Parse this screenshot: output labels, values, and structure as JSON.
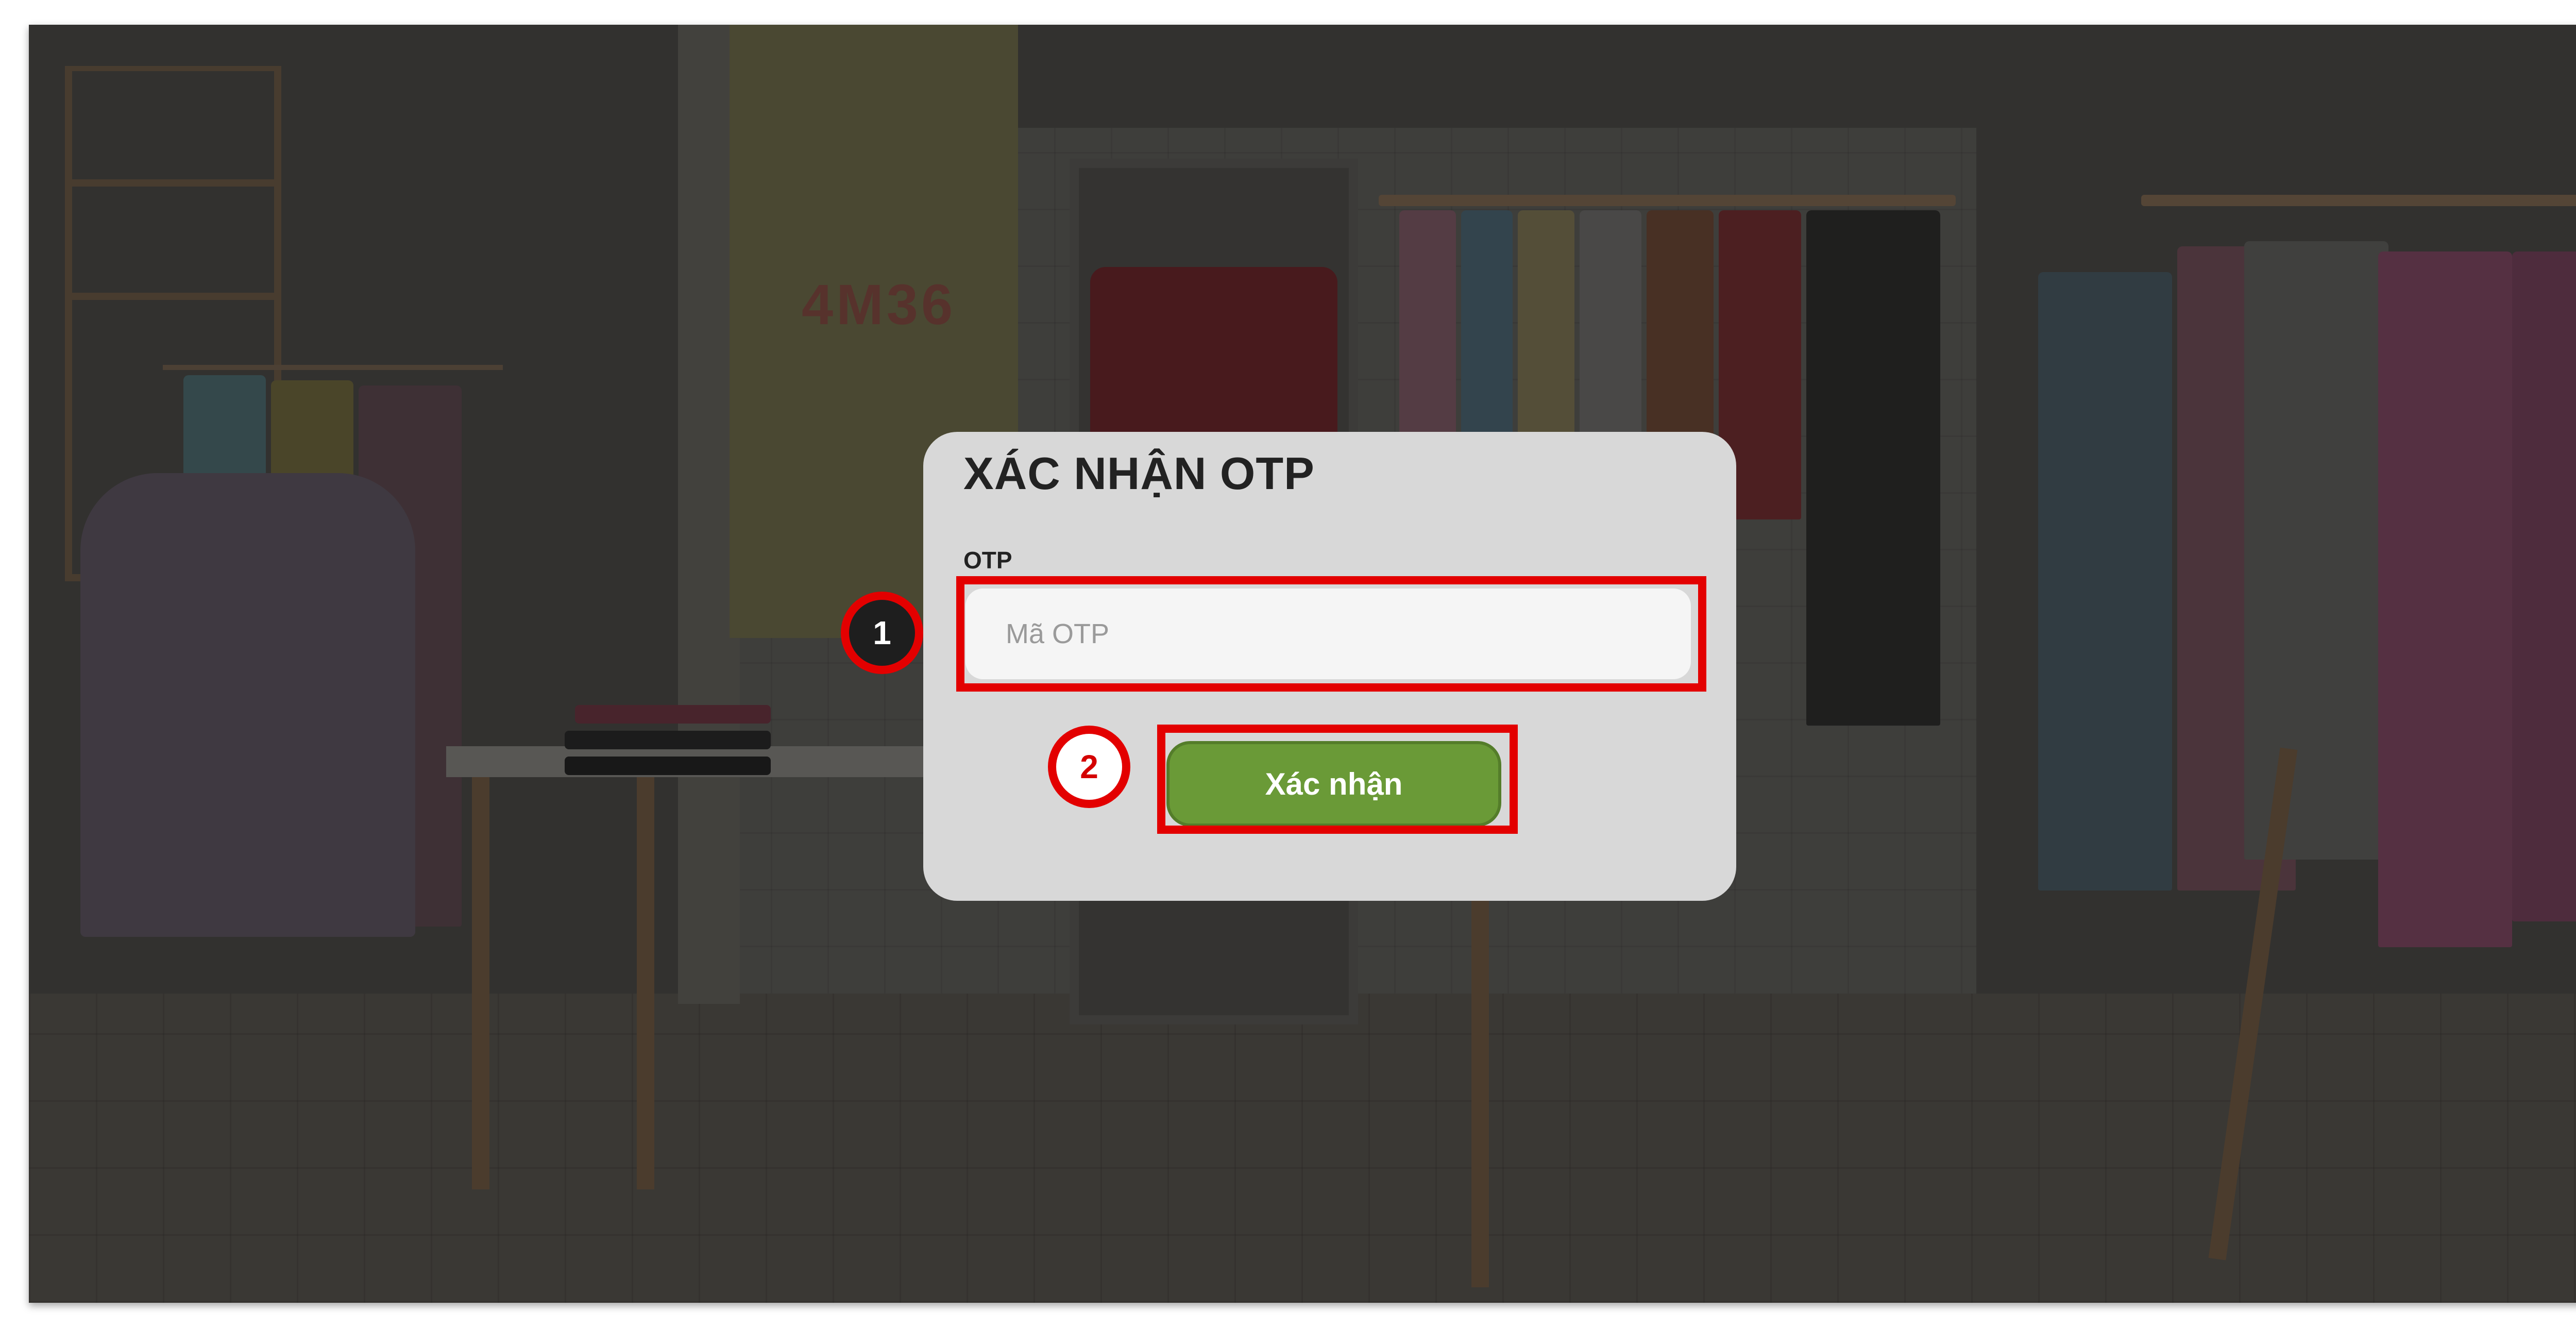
{
  "modal": {
    "title": "XÁC NHẬN OTP",
    "otp_label": "OTP",
    "otp_placeholder": "Mã OTP",
    "otp_value": "",
    "confirm_label": "Xác nhận"
  },
  "background": {
    "poster_text": "4M36"
  },
  "annotations": {
    "step1": "1",
    "step2": "2"
  },
  "colors": {
    "annotation": "#e30000",
    "confirm_button": "#6a9a37",
    "modal_background": "#d8d8d8"
  }
}
